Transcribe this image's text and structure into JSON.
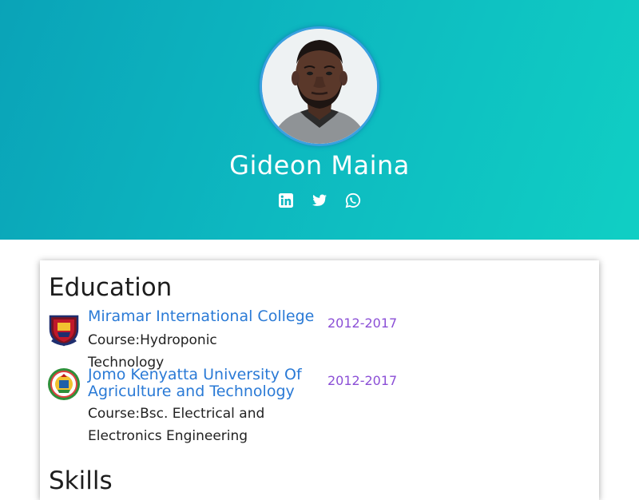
{
  "profile": {
    "name": "Gideon Maina"
  },
  "socials": [
    {
      "icon": "linkedin-icon"
    },
    {
      "icon": "twitter-icon"
    },
    {
      "icon": "whatsapp-icon"
    }
  ],
  "education": {
    "title": "Education",
    "items": [
      {
        "institution": "Miramar International College",
        "course": "Course:Hydroponic Technology",
        "years": "2012-2017",
        "logo": "miramar-logo"
      },
      {
        "institution": "Jomo Kenyatta University Of Agriculture and Technology",
        "course": "Course:Bsc. Electrical and Electronics Engineering",
        "years": "2012-2017",
        "logo": "jkuat-logo"
      }
    ]
  },
  "skills": {
    "title": "Skills"
  },
  "colors": {
    "hero_gradient_start": "#0aa3b8",
    "hero_gradient_end": "#10cfc4",
    "link": "#2a7ad6",
    "years": "#8b4fd6"
  }
}
